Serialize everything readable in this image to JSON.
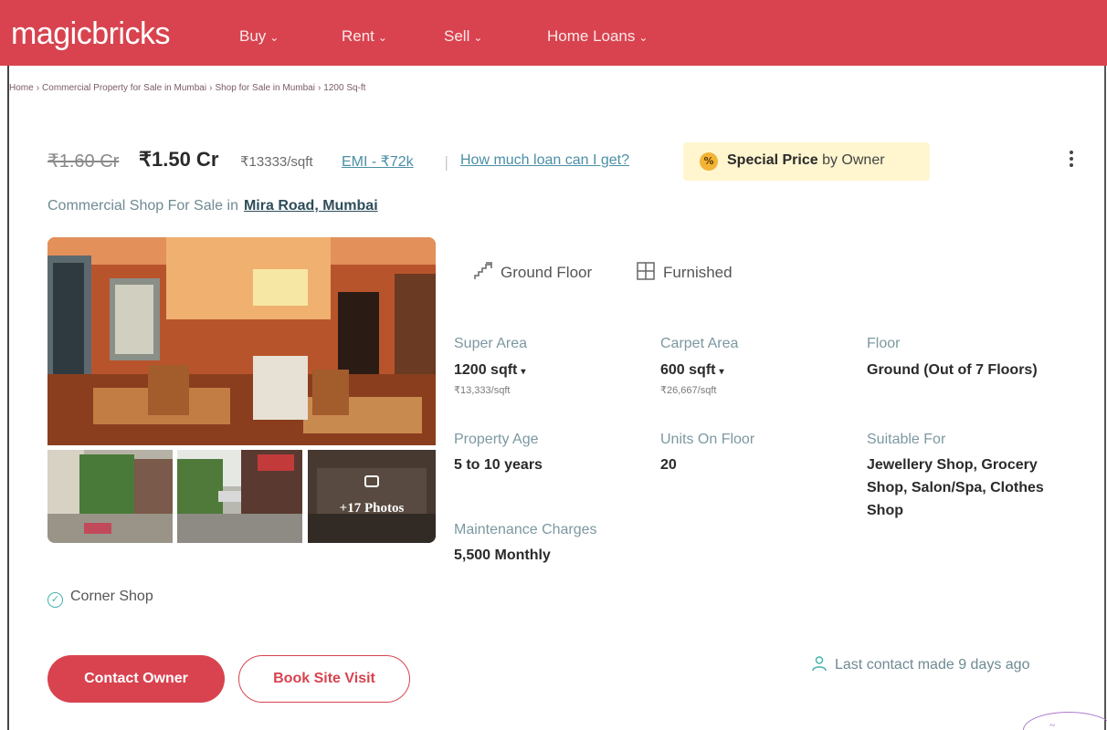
{
  "header": {
    "logo": "magicbricks",
    "nav": [
      {
        "label": "Buy"
      },
      {
        "label": "Rent"
      },
      {
        "label": "Sell"
      },
      {
        "label": "Home Loans"
      }
    ]
  },
  "breadcrumb": [
    "Home",
    "Commercial Property for Sale in Mumbai",
    "Shop for Sale in Mumbai",
    "1200 Sq-ft"
  ],
  "listing": {
    "old_price": "₹1.60 Cr",
    "price": "₹1.50 Cr",
    "price_per_sqft": "₹13333/sqft",
    "emi": "EMI - ₹72k",
    "loan_link": "How much loan can I get?",
    "special_bold": "Special Price",
    "special_rest": " by Owner",
    "special_badge": "%",
    "subtitle": "Commercial Shop For Sale in",
    "location": "Mira Road, Mumbai"
  },
  "photos": {
    "more_label": "+17 Photos"
  },
  "tags": [
    {
      "label": "Ground Floor",
      "icon": "stairs-icon"
    },
    {
      "label": "Furnished",
      "icon": "window-icon"
    }
  ],
  "facts": {
    "super_area": {
      "label": "Super Area",
      "value": "1200 sqft",
      "sub": "₹13,333/sqft"
    },
    "carpet_area": {
      "label": "Carpet Area",
      "value": "600 sqft",
      "sub": "₹26,667/sqft"
    },
    "floor": {
      "label": "Floor",
      "value": "Ground (Out of 7 Floors)"
    },
    "property_age": {
      "label": "Property Age",
      "value": "5 to 10 years"
    },
    "units_on_floor": {
      "label": "Units On Floor",
      "value": "20"
    },
    "suitable_for": {
      "label": "Suitable For",
      "line1": "Jewellery Shop, Grocery",
      "line2": "Shop, Salon/Spa, Clothes",
      "line3": "Shop"
    },
    "maintenance": {
      "label": "Maintenance Charges",
      "value": "5,500 Monthly"
    }
  },
  "amenity": "Corner Shop",
  "actions": {
    "contact": "Contact Owner",
    "visit": "Book Site Visit",
    "last_contact": "Last contact made 9 days ago"
  },
  "colors": {
    "brand": "#d8434f",
    "link": "#4a8fa6",
    "special_bg": "#fff6cf"
  }
}
